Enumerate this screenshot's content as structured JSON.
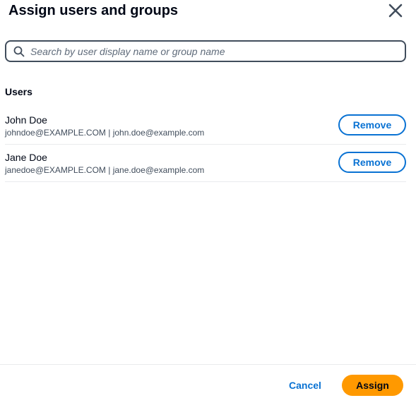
{
  "dialog": {
    "title": "Assign users and groups",
    "close_icon": "close-icon"
  },
  "search": {
    "placeholder": "Search by user display name or group name",
    "value": "",
    "icon": "search-icon"
  },
  "users_section": {
    "title": "Users",
    "items": [
      {
        "name": "John Doe",
        "details": "johndoe@EXAMPLE.COM | john.doe@example.com",
        "remove_label": "Remove"
      },
      {
        "name": "Jane Doe",
        "details": "janedoe@EXAMPLE.COM | jane.doe@example.com",
        "remove_label": "Remove"
      }
    ]
  },
  "footer": {
    "cancel_label": "Cancel",
    "assign_label": "Assign"
  },
  "colors": {
    "primary_button": "#ff9900",
    "link_blue": "#0972d3",
    "text_dark": "#000716",
    "input_border": "#414d5c",
    "divider": "#e9ebed"
  }
}
